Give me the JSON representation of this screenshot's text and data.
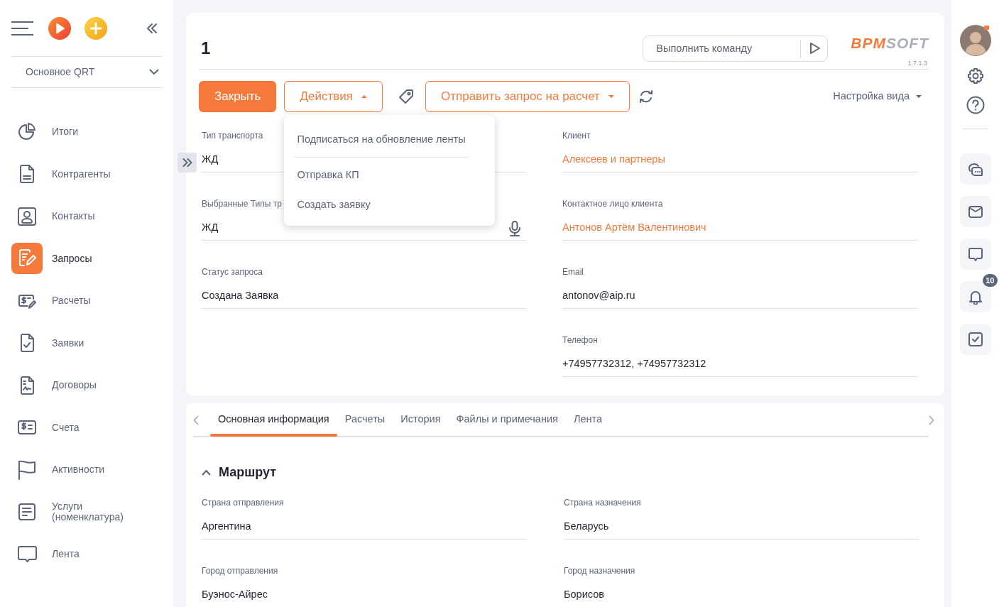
{
  "sidebar": {
    "workspace": "Основное QRT",
    "items": [
      {
        "label": "Итоги",
        "selected": false
      },
      {
        "label": "Контрагенты",
        "selected": false
      },
      {
        "label": "Контакты",
        "selected": false
      },
      {
        "label": "Запросы",
        "selected": true
      },
      {
        "label": "Расчеты",
        "selected": false
      },
      {
        "label": "Заявки",
        "selected": false
      },
      {
        "label": "Договоры",
        "selected": false
      },
      {
        "label": "Счета",
        "selected": false
      },
      {
        "label": "Активности",
        "selected": false
      },
      {
        "label": "Услуги (номенклатура)",
        "selected": false
      },
      {
        "label": "Лента",
        "selected": false
      }
    ]
  },
  "header": {
    "title": "1",
    "command_placeholder": "Выполнить команду",
    "logo": {
      "accent": "BPM",
      "rest": "SOFT"
    },
    "version": "1.7.1.3"
  },
  "toolbar": {
    "close": "Закрыть",
    "actions": {
      "label": "Действия",
      "expanded": true
    },
    "send": "Отправить запрос на расчет",
    "view": "Настройка вида"
  },
  "actions_menu": [
    {
      "label": "Подписаться на обновление ленты",
      "divider_after": true
    },
    {
      "label": "Отправка КП",
      "divider_after": false
    },
    {
      "label": "Создать заявку",
      "divider_after": false
    }
  ],
  "fields_left": [
    {
      "label": "Тип транспорта",
      "value": "ЖД",
      "kind": "text",
      "mic": false
    },
    {
      "label": "Выбранные Типы тр",
      "value": "ЖД",
      "kind": "text",
      "mic": true
    },
    {
      "label": "Статус запроса",
      "value": "Создана Заявка",
      "kind": "text",
      "mic": false
    }
  ],
  "fields_right": [
    {
      "label": "Клиент",
      "value": "Алексеев и партнеры",
      "kind": "link",
      "mic": false
    },
    {
      "label": "Контактное лицо клиента",
      "value": "Антонов Артём Валентинович",
      "kind": "link",
      "mic": false
    },
    {
      "label": "Email",
      "value": "antonov@aip.ru",
      "kind": "text",
      "mic": false
    },
    {
      "label": "Телефон",
      "value": "+74957732312, +74957732312",
      "kind": "text",
      "mic": false
    }
  ],
  "tabs": [
    {
      "label": "Основная информация",
      "selected": true
    },
    {
      "label": "Расчеты",
      "selected": false
    },
    {
      "label": "История",
      "selected": false
    },
    {
      "label": "Файлы и примечания",
      "selected": false
    },
    {
      "label": "Лента",
      "selected": false
    }
  ],
  "section": {
    "title": "Маршрут",
    "expanded": true,
    "fields_left": [
      {
        "label": "Страна отправления",
        "value": "Аргентина",
        "kind": "text",
        "mic": false
      },
      {
        "label": "Город отправления",
        "value": "Буэнос-Айрес",
        "kind": "text",
        "mic": false
      }
    ],
    "fields_right": [
      {
        "label": "Страна назначения",
        "value": "Беларусь",
        "kind": "text",
        "mic": false
      },
      {
        "label": "Город назначения",
        "value": "Борисов",
        "kind": "text",
        "mic": false
      }
    ]
  },
  "notifications": {
    "count": "10"
  }
}
